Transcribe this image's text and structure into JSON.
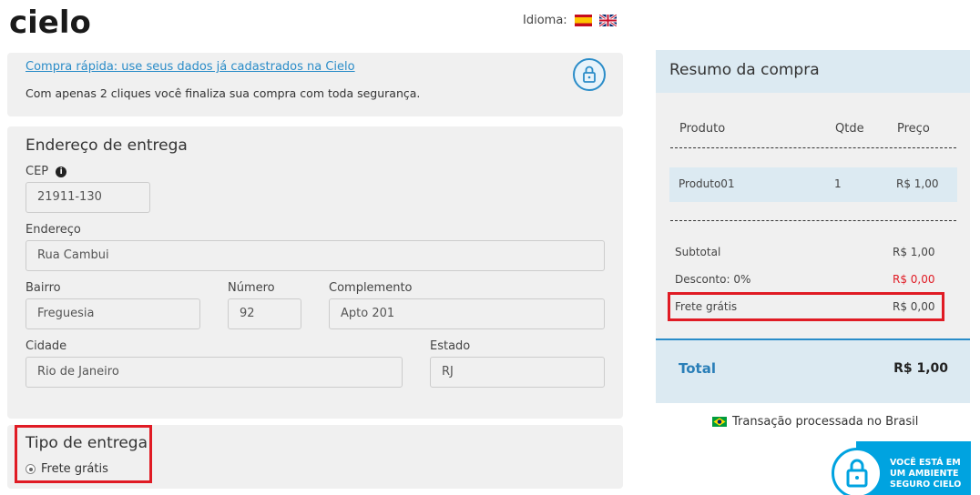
{
  "header": {
    "logo_text": "cielo",
    "language_label": "Idioma:",
    "languages": [
      "spanish-flag",
      "uk-flag"
    ]
  },
  "quick_buy": {
    "link": "Compra rápida: use seus dados já cadastrados na Cielo",
    "text": "Com apenas 2 cliques você finaliza sua compra com toda segurança.",
    "icon": "lock-icon"
  },
  "address": {
    "title": "Endereço de entrega",
    "cep_label": "CEP",
    "cep_value": "21911-130",
    "endereco_label": "Endereço",
    "endereco_value": "Rua Cambui",
    "bairro_label": "Bairro",
    "bairro_value": "Freguesia",
    "numero_label": "Número",
    "numero_value": "92",
    "complemento_label": "Complemento",
    "complemento_value": "Apto 201",
    "cidade_label": "Cidade",
    "cidade_value": "Rio de Janeiro",
    "estado_label": "Estado",
    "estado_value": "RJ"
  },
  "delivery": {
    "title": "Tipo de entrega",
    "option": "Frete grátis"
  },
  "summary": {
    "title": "Resumo da compra",
    "col_product": "Produto",
    "col_qty": "Qtde",
    "col_price": "Preço",
    "item_name": "Produto01",
    "item_qty": "1",
    "item_price": "R$ 1,00",
    "subtotal_label": "Subtotal",
    "subtotal_value": "R$ 1,00",
    "discount_label": "Desconto: 0%",
    "discount_value": "R$ 0,00",
    "shipping_label": "Frete grátis",
    "shipping_value": "R$ 0,00",
    "total_label": "Total",
    "total_value": "R$ 1,00"
  },
  "footer": {
    "brazil_note": "Transação processada no Brasil",
    "secure_badge": "VOCÊ ESTÁ EM\nUM AMBIENTE\nSEGURO CIELO"
  },
  "colors": {
    "accent": "#2a8cc8",
    "highlight_border": "#e01b24",
    "discount_red": "#e01b24",
    "secure_blue": "#00a3e0"
  }
}
